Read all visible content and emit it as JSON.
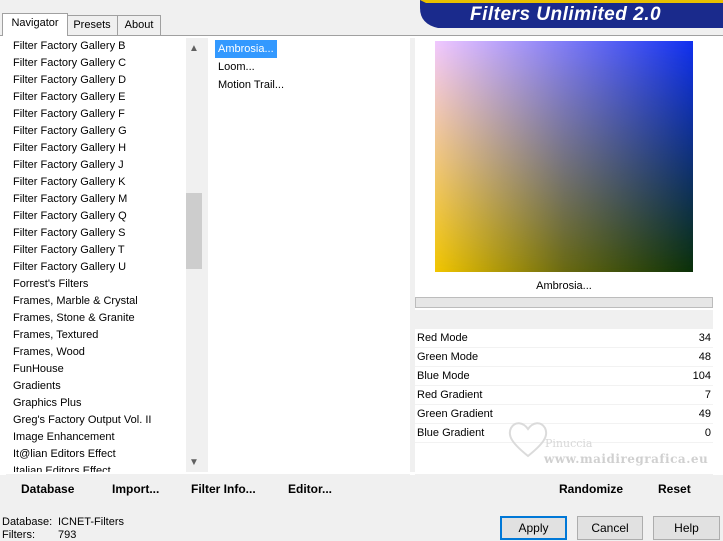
{
  "tabs": [
    {
      "label": "Navigator",
      "active": true
    },
    {
      "label": "Presets",
      "active": false
    },
    {
      "label": "About",
      "active": false
    }
  ],
  "banner": {
    "title": "Filters Unlimited 2.0",
    "color": "#1a2a8c"
  },
  "categories": [
    "Filter Factory Gallery B",
    "Filter Factory Gallery C",
    "Filter Factory Gallery D",
    "Filter Factory Gallery E",
    "Filter Factory Gallery F",
    "Filter Factory Gallery G",
    "Filter Factory Gallery H",
    "Filter Factory Gallery J",
    "Filter Factory Gallery K",
    "Filter Factory Gallery M",
    "Filter Factory Gallery Q",
    "Filter Factory Gallery S",
    "Filter Factory Gallery T",
    "Filter Factory Gallery U",
    "Forrest's Filters",
    "Frames, Marble & Crystal",
    "Frames, Stone & Granite",
    "Frames, Textured",
    "Frames, Wood",
    "FunHouse",
    "Gradients",
    "Graphics Plus",
    "Greg's Factory Output Vol. II",
    "Image Enhancement",
    "It@lian Editors Effect",
    "Italian Editors Effect"
  ],
  "filters": [
    {
      "label": "Ambrosia...",
      "selected": true
    },
    {
      "label": "Loom...",
      "selected": false
    },
    {
      "label": "Motion Trail...",
      "selected": false
    }
  ],
  "preview": {
    "label": "Ambrosia..."
  },
  "params": [
    {
      "name": "Red Mode",
      "value": "34"
    },
    {
      "name": "Green Mode",
      "value": "48"
    },
    {
      "name": "Blue Mode",
      "value": "104"
    },
    {
      "name": "Red Gradient",
      "value": "7"
    },
    {
      "name": "Green Gradient",
      "value": "49"
    },
    {
      "name": "Blue Gradient",
      "value": "0"
    }
  ],
  "toolbar": {
    "database": "Database",
    "import": "Import...",
    "filter_info": "Filter Info...",
    "editor": "Editor...",
    "randomize": "Randomize",
    "reset": "Reset"
  },
  "status": {
    "database_label": "Database:",
    "database_value": "ICNET-Filters",
    "filters_label": "Filters:",
    "filters_value": "793"
  },
  "buttons": {
    "apply": "Apply",
    "cancel": "Cancel",
    "help": "Help"
  },
  "watermark": {
    "name": "Pinuccia",
    "url": "www.maidiregrafica.eu"
  },
  "colors": {
    "selection": "#3399ff",
    "banner": "#1a2a8c"
  }
}
